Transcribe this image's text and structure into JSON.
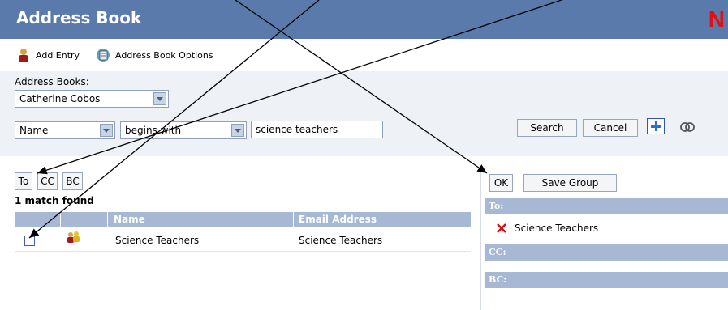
{
  "window": {
    "title": "Address Book",
    "logo_letter": "N"
  },
  "toolbar": {
    "add_entry": "Add Entry",
    "options": "Address Book Options"
  },
  "search": {
    "address_books_label": "Address Books:",
    "book_selected": "Catherine Cobos",
    "field_selected": "Name",
    "operator_selected": "begins with",
    "query": "science teachers",
    "search_label": "Search",
    "cancel_label": "Cancel"
  },
  "results": {
    "to_label": "To",
    "cc_label": "CC",
    "bc_label": "BC",
    "match_text": "1 match found",
    "columns": [
      "",
      "",
      "Name",
      "Email Address"
    ],
    "rows": [
      {
        "name": "Science Teachers",
        "email": "Science Teachers",
        "checked": false
      }
    ]
  },
  "recipients": {
    "ok_label": "OK",
    "save_group_label": "Save Group",
    "to_header": "To:",
    "cc_header": "CC:",
    "bc_header": "BC:",
    "to_items": [
      "Science Teachers"
    ]
  },
  "colors": {
    "header": "#5a7aab",
    "table_header": "#a6b8d4",
    "panel": "#eef1f6",
    "remove": "#d01010"
  },
  "icons": [
    "add-entry-icon",
    "address-book-options-icon",
    "group-contact-icon",
    "remove-icon",
    "plus-icon",
    "rings-icon"
  ]
}
